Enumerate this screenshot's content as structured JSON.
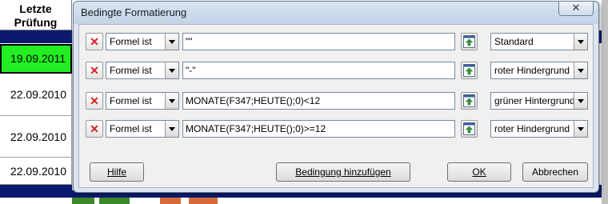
{
  "sheet": {
    "header_line1": "Letzte",
    "header_line2": "Prüfung",
    "dates": [
      "19.09.2011",
      "22.09.2010",
      "22.09.2010",
      "22.09.2010"
    ]
  },
  "dialog": {
    "title": "Bedingte Formatierung",
    "close_label": "✕",
    "rows": [
      {
        "type": "Formel ist",
        "formula": "\"\"",
        "style": "Standard"
      },
      {
        "type": "Formel ist",
        "formula": "\"-\"",
        "style": "roter Hindergrund"
      },
      {
        "type": "Formel ist",
        "formula": "MONATE(F347;HEUTE();0)<12",
        "style": "grüner Hintergrund"
      },
      {
        "type": "Formel ist",
        "formula": "MONATE(F347;HEUTE();0)>=12",
        "style": "roter Hindergrund"
      }
    ],
    "buttons": {
      "help": "Hilfe",
      "add_condition": "Bedingung hinzufügen",
      "ok": "OK",
      "cancel": "Abbrechen"
    }
  },
  "colors": {
    "highlight_green": "#22ee22",
    "navy_band": "#0c1a6e",
    "delete_red": "#d62020"
  },
  "icons": {
    "delete": "delete-x-icon",
    "shrink": "shrink-dialog-icon",
    "dropdown": "chevron-down-icon"
  }
}
